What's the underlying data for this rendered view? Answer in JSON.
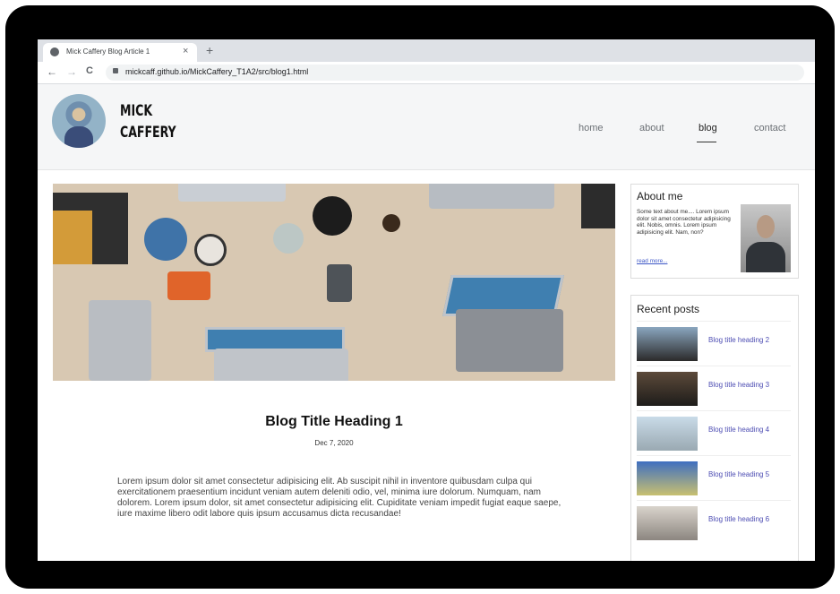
{
  "browser": {
    "tab_title": "Mick Caffery Blog Article 1",
    "tab_close": "×",
    "new_tab": "+",
    "back": "←",
    "forward": "→",
    "reload": "C",
    "url": "mickcaff.github.io/MickCaffery_T1A2/src/blog1.html"
  },
  "site": {
    "brand_line1": "MICK",
    "brand_line2": "CAFFERY",
    "nav": [
      {
        "label": "home"
      },
      {
        "label": "about"
      },
      {
        "label": "blog",
        "active": true
      },
      {
        "label": "contact"
      }
    ]
  },
  "article": {
    "title": "Blog Title Heading 1",
    "date": "Dec 7, 2020",
    "body": "Lorem ipsum dolor sit amet consectetur adipisicing elit. Ab suscipit nihil in inventore quibusdam culpa qui exercitationem praesentium incidunt veniam autem deleniti odio, vel, minima iure dolorum. Numquam, nam dolorem. Lorem ipsum dolor, sit amet consectetur adipisicing elit. Cupiditate veniam impedit fugiat eaque saepe, iure maxime libero odit labore quis ipsum accusamus dicta recusandae!"
  },
  "sidebar": {
    "about": {
      "title": "About me",
      "text": "Some text about me.... Lorem ipsum dolor sit amet consectetur adipisicing elit. Nobis, omnis. Lorem ipsum adipisicing elit. Nam, non?",
      "link": "read more..."
    },
    "recent": {
      "title": "Recent posts",
      "posts": [
        {
          "label": "Blog title heading 2",
          "colors": [
            "#8aa6bf",
            "#2b2a2a"
          ]
        },
        {
          "label": "Blog title heading 3",
          "colors": [
            "#5c4a3a",
            "#1e1c1a"
          ]
        },
        {
          "label": "Blog title heading 4",
          "colors": [
            "#c9dbe8",
            "#9aa9b2"
          ]
        },
        {
          "label": "Blog title heading 5",
          "colors": [
            "#3f6fc0",
            "#c8c070"
          ]
        },
        {
          "label": "Blog title heading 6",
          "colors": [
            "#d9d4cc",
            "#8c8680"
          ]
        }
      ]
    }
  }
}
